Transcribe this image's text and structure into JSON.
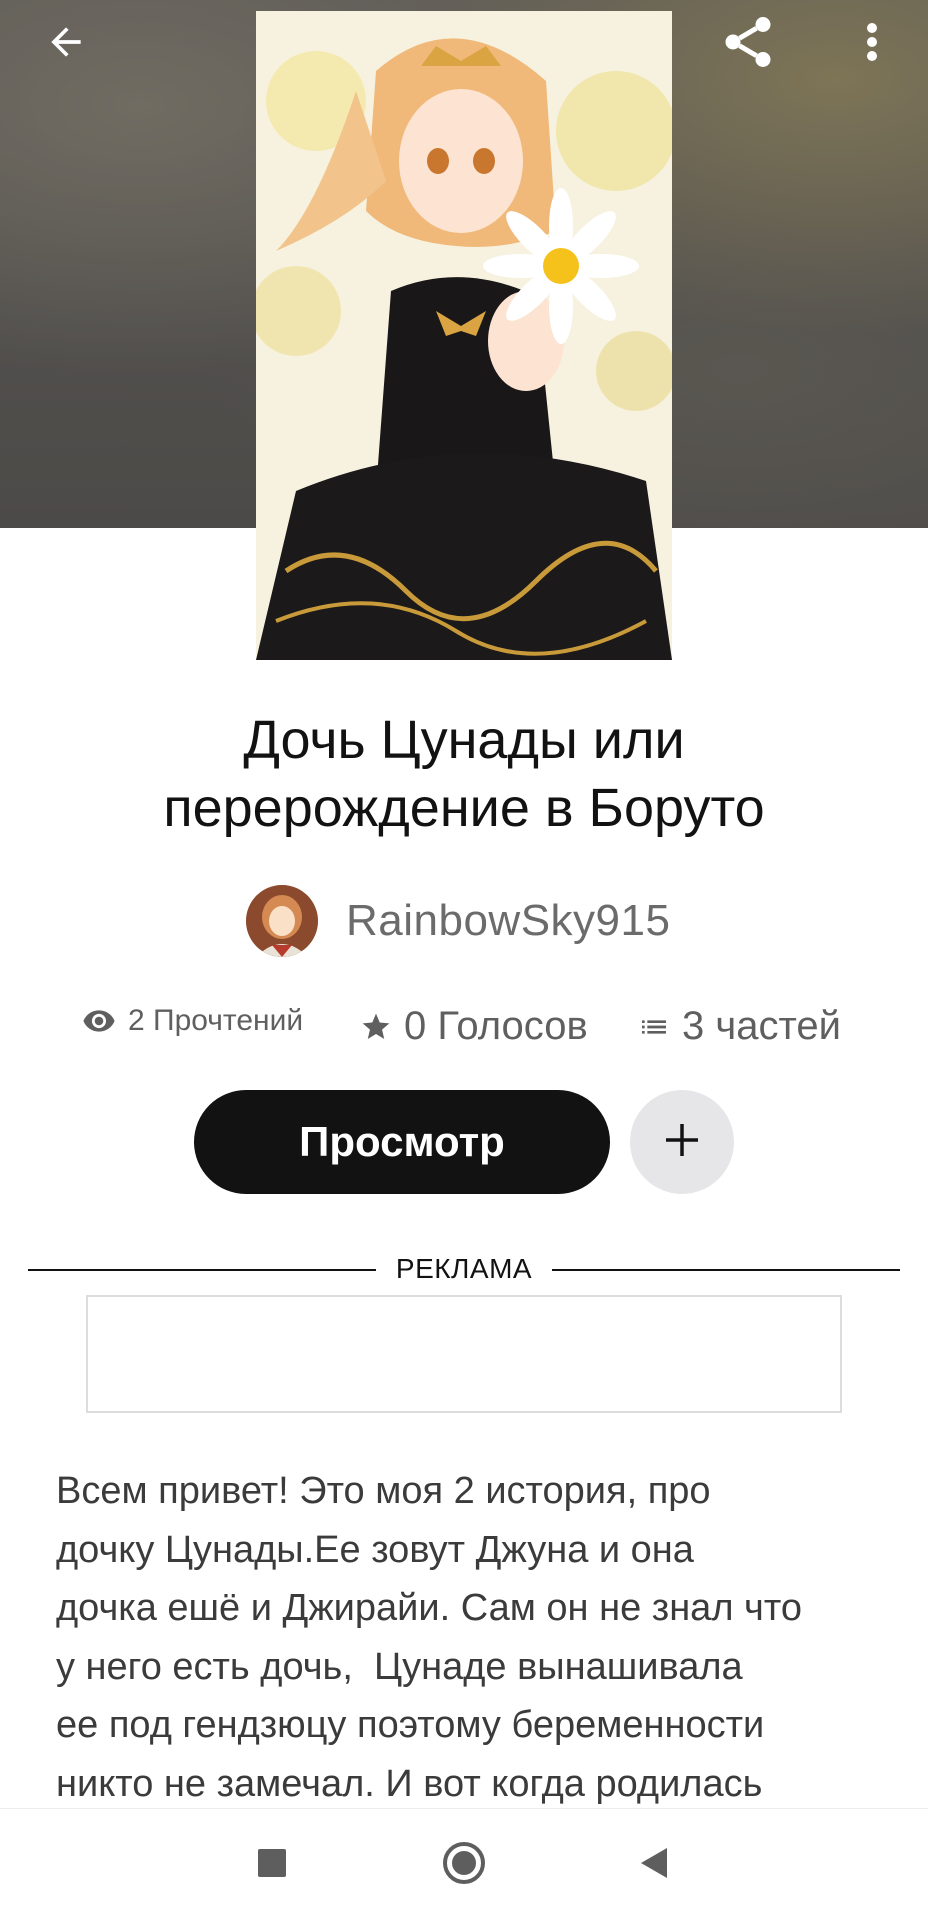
{
  "header": {
    "back_icon": "arrow-left-icon",
    "share_icon": "share-icon",
    "more_icon": "more-vert-icon"
  },
  "cover": {
    "image": "anime-girl-black-dress-daisy-illustration"
  },
  "story": {
    "title_line1": "Дочь Цунады или",
    "title_line2": "перерождение в Боруто",
    "author": "RainbowSky915"
  },
  "stats": {
    "reads": "2 Прочтений",
    "votes": "0 Голосов",
    "parts": "3 частей"
  },
  "actions": {
    "view_label": "Просмотр",
    "add_icon": "plus-icon"
  },
  "ad": {
    "label": "РЕКЛАМА"
  },
  "description": {
    "lines": [
      "Всем привет! Это моя 2 история, про",
      "дочку Цунады.Ее зовут Джуна и она",
      "дочка ешё и Джирайи. Сам он не знал что",
      "у него есть дочь,  Цунаде вынашивала",
      "ее под гендзюцу поэтому беременности",
      "никто не замечал. И вот когда родилась"
    ]
  },
  "navbar": {
    "recent_icon": "square-icon",
    "home_icon": "circle-home-icon",
    "back_icon": "triangle-back-icon"
  },
  "colors": {
    "primary_button": "#121212",
    "secondary_button": "#e6e5e8",
    "muted_text": "#6b6b6b",
    "body_text": "#3b3b3b"
  }
}
